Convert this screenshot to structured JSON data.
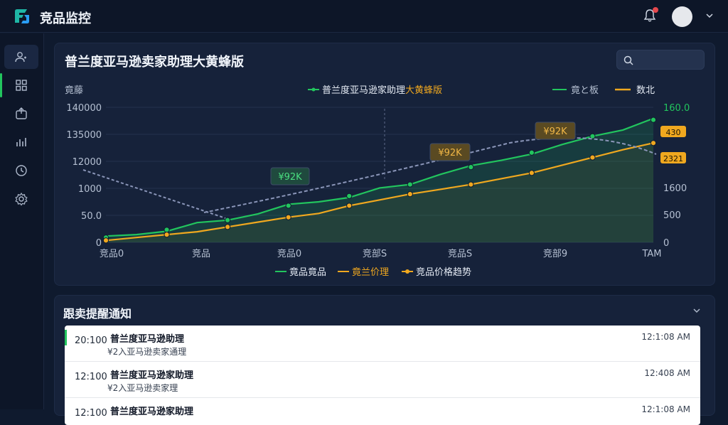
{
  "app": {
    "title": "竞品监控"
  },
  "colors": {
    "accent_green": "#22c55e",
    "accent_amber": "#f0a81f",
    "bg": "#0f1a2e",
    "panel": "#16223a",
    "alert": "#e5484d"
  },
  "icons": {
    "logo": "app-logo-icon",
    "bell": "bell-icon",
    "search": "search-icon"
  },
  "sidebar": {
    "items": [
      {
        "name": "users-icon"
      },
      {
        "name": "grid-icon"
      },
      {
        "name": "export-icon"
      },
      {
        "name": "bar-chart-icon"
      },
      {
        "name": "clock-icon"
      },
      {
        "name": "settings-icon"
      }
    ]
  },
  "chart_panel": {
    "title": "普兰度亚马逊卖家助理大黄蜂版",
    "search_placeholder": ""
  },
  "chart_data": {
    "type": "line",
    "title": "",
    "ylabel_left": "竟藤",
    "y_left_ticks": [
      "140000",
      "135000",
      "12000",
      "1000",
      "50.0",
      "0"
    ],
    "y_right_ticks": [
      "160.0",
      "1600",
      "500",
      "0"
    ],
    "y_right_badges": [
      "430",
      "2321"
    ],
    "x_ticks": [
      "竞品0",
      "竞品",
      "竞品0",
      "竞部S",
      "竞品S",
      "竞部9",
      "TAM"
    ],
    "top_legend": [
      {
        "name": "普兰度亚马逊家助理",
        "suffix": "大黄蜂版",
        "color": "#22c55e"
      },
      {
        "name": "竟と板",
        "color": "#22c55e"
      },
      {
        "name": "数北",
        "color": "#f0a81f"
      }
    ],
    "bottom_legend": [
      {
        "name": "竟品竟品",
        "color": "#22c55e"
      },
      {
        "name": "竟兰价理",
        "color": "#f0a81f"
      },
      {
        "name": "竞品价格趋势",
        "color": "#f0a81f"
      }
    ],
    "annotations": [
      "¥92K",
      "¥92K",
      "¥92K"
    ],
    "ylim": [
      0,
      140000
    ],
    "series": [
      {
        "color": "#22c55e",
        "values": [
          5000,
          8000,
          13000,
          19000,
          23000,
          31000,
          38000,
          42000,
          48000,
          55000,
          60000,
          72000,
          78000,
          85000,
          93000,
          100000,
          110000,
          118000,
          127000
        ]
      },
      {
        "color": "#f0a81f",
        "values": [
          2000,
          5000,
          8000,
          11000,
          16000,
          21000,
          26000,
          30000,
          38000,
          44000,
          50000,
          55000,
          60000,
          66000,
          72000,
          80000,
          88000,
          96000,
          103000
        ]
      }
    ],
    "grid": true
  },
  "notifications": {
    "title": "跟卖提醒通知",
    "items": [
      {
        "time": "20:100",
        "title": "普兰度亚马逊助理",
        "desc": "¥2入亚马逊卖家通理",
        "right": "12:1:08 AM"
      },
      {
        "time": "12:100",
        "title": "普兰度亚马逊家助理",
        "desc": "¥2入亚马逊卖家理",
        "right": "12:408 AM"
      },
      {
        "time": "12:100",
        "title": "普兰度亚马逊家助理",
        "desc": "",
        "right": "12:1:08 AM"
      }
    ]
  }
}
